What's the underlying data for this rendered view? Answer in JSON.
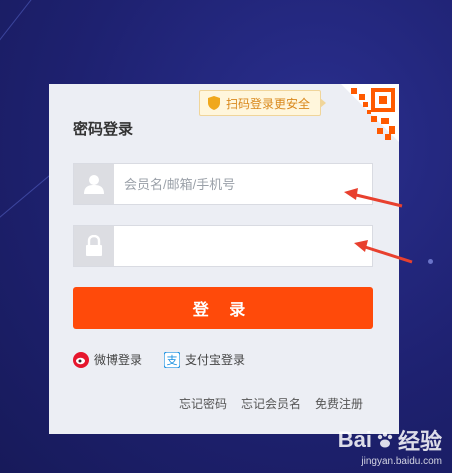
{
  "login": {
    "title": "密码登录",
    "scan_tip": "扫码登录更安全",
    "username_placeholder": "会员名/邮箱/手机号",
    "password_value": "",
    "submit_label": "登 录",
    "alt_logins": {
      "weibo": "微博登录",
      "alipay": "支付宝登录"
    },
    "links": {
      "forgot_password": "忘记密码",
      "forgot_username": "忘记会员名",
      "register": "免费注册"
    }
  },
  "watermark": {
    "brand": "Bai",
    "brand_suffix": "经验",
    "url": "jingyan.baidu.com"
  },
  "colors": {
    "accent": "#ff4a0a",
    "background": "#1e2170",
    "arrow": "#e8402e"
  }
}
